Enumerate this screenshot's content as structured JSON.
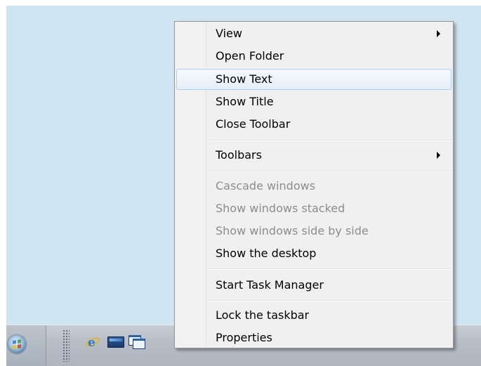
{
  "menu": {
    "items": [
      {
        "label": "View",
        "submenu": true,
        "state": "normal"
      },
      {
        "label": "Open Folder",
        "submenu": false,
        "state": "normal"
      },
      {
        "label": "Show Text",
        "submenu": false,
        "state": "hover"
      },
      {
        "label": "Show Title",
        "submenu": false,
        "state": "normal"
      },
      {
        "label": "Close Toolbar",
        "submenu": false,
        "state": "normal"
      },
      {
        "label": "Toolbars",
        "submenu": true,
        "state": "normal"
      },
      {
        "label": "Cascade windows",
        "submenu": false,
        "state": "disabled"
      },
      {
        "label": "Show windows stacked",
        "submenu": false,
        "state": "disabled"
      },
      {
        "label": "Show windows side by side",
        "submenu": false,
        "state": "disabled"
      },
      {
        "label": "Show the desktop",
        "submenu": false,
        "state": "normal"
      },
      {
        "label": "Start Task Manager",
        "submenu": false,
        "state": "normal"
      },
      {
        "label": "Lock the taskbar",
        "submenu": false,
        "state": "normal"
      },
      {
        "label": "Properties",
        "submenu": false,
        "state": "normal"
      }
    ]
  },
  "taskbar": {
    "icons": [
      "start-orb-icon",
      "internet-explorer-icon",
      "show-desktop-icon",
      "switch-windows-icon"
    ]
  },
  "colors": {
    "desktop": "#cfe5f2",
    "menu_background": "#f0f0f0",
    "hover_border": "#aecff7",
    "disabled_text": "#8d8d8d"
  }
}
